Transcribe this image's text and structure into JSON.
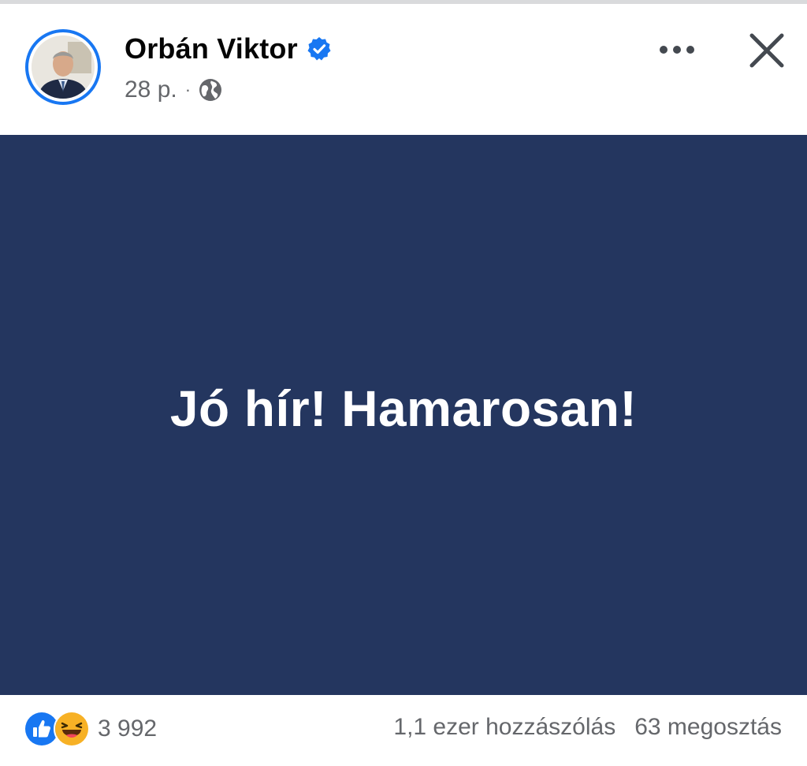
{
  "post": {
    "author_name": "Orbán Viktor",
    "timestamp": "28 p.",
    "separator": "·",
    "privacy_icon": "globe-icon",
    "verified_icon": "verified-badge-icon",
    "image_text": "Jó hír! Hamarosan!"
  },
  "actions": {
    "more_icon": "more-options-icon",
    "close_icon": "close-icon"
  },
  "footer": {
    "reaction_icons": [
      "like-icon",
      "haha-icon"
    ],
    "reaction_count": "3 992",
    "comments": "1,1 ezer hozzászólás",
    "shares": "63 megosztás"
  },
  "colors": {
    "brand_blue": "#1877f2",
    "image_background": "#24365f",
    "secondary_text": "#65676b"
  }
}
